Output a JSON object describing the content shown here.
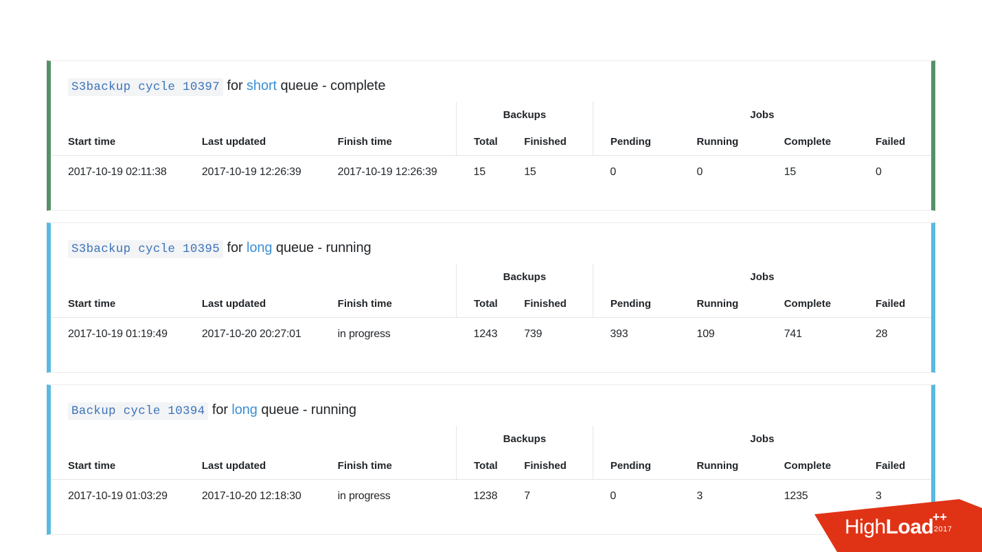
{
  "table": {
    "group_spacer": "",
    "groups": [
      {
        "label": "Backups"
      },
      {
        "label": "Jobs"
      }
    ],
    "columns": [
      "Start time",
      "Last updated",
      "Finish time",
      "Total",
      "Finished",
      "Pending",
      "Running",
      "Complete",
      "Failed"
    ]
  },
  "colors": {
    "complete_accent": "#569068",
    "running_accent": "#5bb9e0",
    "link": "#3b8fd4",
    "code": "#3b74b8",
    "code_bg": "#f3f4f6",
    "logo_red": "#e03316"
  },
  "cards": [
    {
      "code": "S3backup cycle 10397",
      "for_word": "for",
      "queue": "short",
      "queue_suffix": "queue - complete",
      "status": "complete",
      "values": {
        "start_time": "2017-10-19 02:11:38",
        "last_updated": "2017-10-19 12:26:39",
        "finish_time": "2017-10-19 12:26:39",
        "backups_total": "15",
        "backups_finished": "15",
        "jobs_pending": "0",
        "jobs_running": "0",
        "jobs_complete": "15",
        "jobs_failed": "0"
      }
    },
    {
      "code": "S3backup cycle 10395",
      "for_word": "for",
      "queue": "long",
      "queue_suffix": "queue - running",
      "status": "running",
      "values": {
        "start_time": "2017-10-19 01:19:49",
        "last_updated": "2017-10-20 20:27:01",
        "finish_time": "in progress",
        "backups_total": "1243",
        "backups_finished": "739",
        "jobs_pending": "393",
        "jobs_running": "109",
        "jobs_complete": "741",
        "jobs_failed": "28"
      }
    },
    {
      "code": "Backup cycle 10394",
      "for_word": "for",
      "queue": "long",
      "queue_suffix": "queue - running",
      "status": "running",
      "values": {
        "start_time": "2017-10-19 01:03:29",
        "last_updated": "2017-10-20 12:18:30",
        "finish_time": "in progress",
        "backups_total": "1238",
        "backups_finished": "7",
        "jobs_pending": "0",
        "jobs_running": "3",
        "jobs_complete": "1235",
        "jobs_failed": "3"
      }
    }
  ],
  "logo": {
    "part1": "High",
    "part2": "Load",
    "plus": "++",
    "year": "2017"
  }
}
